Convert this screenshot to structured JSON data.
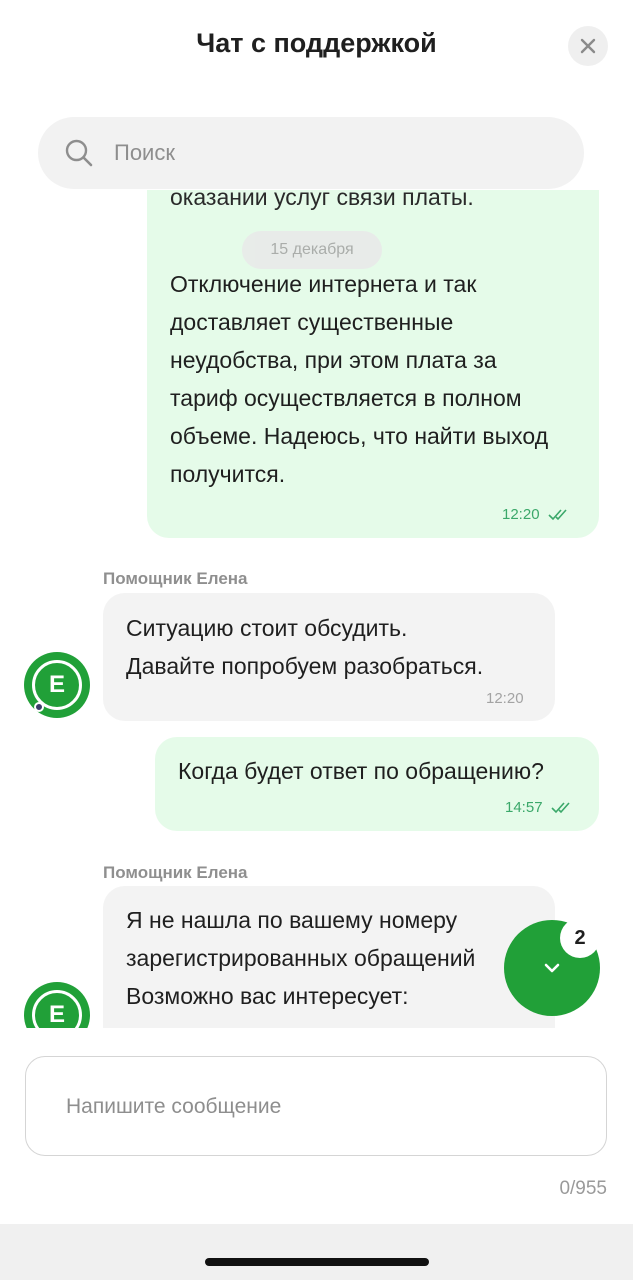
{
  "header": {
    "title": "Чат с поддержкой",
    "close_icon": "close-icon"
  },
  "search": {
    "icon": "search-icon",
    "placeholder": "Поиск"
  },
  "messages": [
    {
      "direction": "out",
      "partial_text": "оказании услуг связи платы.",
      "date_separator": "15 декабря",
      "lines": [
        "Отключение интернета и так",
        "доставляет существенные",
        "неудобства, при этом плата за",
        "тариф осуществляется в полном",
        "объеме. Надеюсь, что найти выход",
        "получится."
      ],
      "time": "12:20",
      "status": "read"
    },
    {
      "direction": "in",
      "sender": "Помощник Елена",
      "lines": [
        "Ситуацию стоит обсудить.",
        "Давайте попробуем разобраться."
      ],
      "time": "12:20"
    },
    {
      "direction": "out",
      "lines": [
        "Когда будет ответ по обращению?"
      ],
      "time": "14:57",
      "status": "read"
    },
    {
      "direction": "in",
      "sender": "Помощник Елена",
      "lines": [
        "Я не нашла по вашему номеру",
        "зарегистрированных обращений",
        "Возможно вас интересует:"
      ]
    }
  ],
  "avatar": {
    "letter": "Е"
  },
  "scroll_button": {
    "icon": "chevron-down-icon",
    "unread_count": "2"
  },
  "composer": {
    "placeholder": "Напишите сообщение",
    "counter": "0/955"
  },
  "colors": {
    "accent": "#21a038",
    "out_bubble": "#e5fbe9",
    "in_bubble": "#f3f3f3",
    "read_ticks": "#3ba86a"
  }
}
